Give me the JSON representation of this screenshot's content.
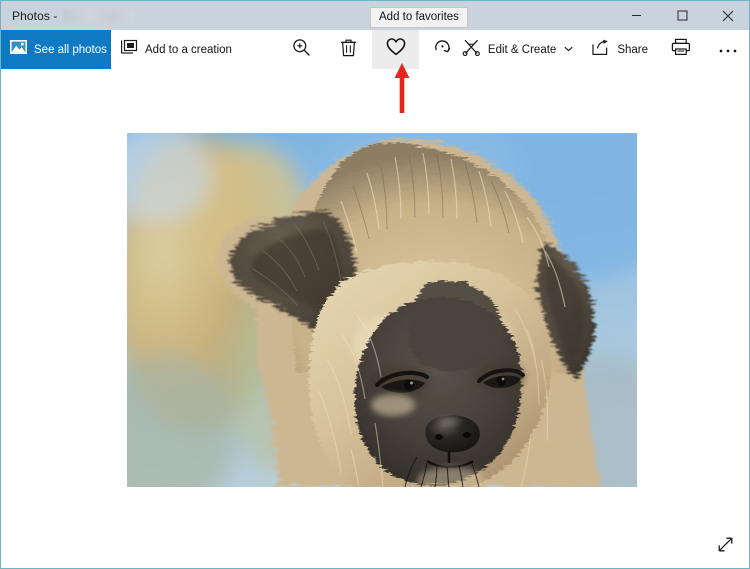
{
  "window": {
    "title": "Photos -",
    "title_redacted": true,
    "accent_blue": "#0e7ac4",
    "titlebar_bg": "#c9d3dd",
    "controls": [
      {
        "name": "minimize",
        "label": "Minimize"
      },
      {
        "name": "maximize",
        "label": "Maximize"
      },
      {
        "name": "close",
        "label": "Close"
      }
    ]
  },
  "toolbar": {
    "see_all_photos": {
      "label": "See all photos",
      "icon": "photo-icon"
    },
    "add_to_creation": {
      "label": "Add to a creation",
      "icon": "add-to-creation-icon"
    },
    "zoom": {
      "icon": "zoom-in-icon",
      "label": "Zoom"
    },
    "delete": {
      "icon": "trash-icon",
      "label": "Delete"
    },
    "favorite": {
      "icon": "heart-icon",
      "label": "Add to favorites",
      "active": true
    },
    "rotate": {
      "icon": "rotate-icon",
      "label": "Rotate"
    },
    "edit_create": {
      "label": "Edit & Create",
      "icon": "edit-create-icon",
      "chevron": "⌄"
    },
    "share": {
      "label": "Share",
      "icon": "share-icon"
    },
    "print": {
      "icon": "print-icon",
      "label": "Print"
    },
    "more": {
      "label": "···",
      "icon": "more-options-icon"
    }
  },
  "tooltip": {
    "text": "Add to favorites",
    "target": "favorite-button"
  },
  "annotation": {
    "type": "arrow",
    "color": "#e8251c",
    "direction": "up",
    "points_to": "favorite-button"
  },
  "viewer": {
    "image_alt": "Close-up photo of a fluffy tan and gray puppy against a blue sky and blurred autumn foliage",
    "expand_button": {
      "icon": "expand-diagonal-icon",
      "label": "Enter fullscreen"
    },
    "photo_colors": {
      "sky": "#87b6dc",
      "foliage": "#c9b27a",
      "fur_light": "#d9c49d",
      "fur_dark": "#4c463f",
      "muzzle": "#3a352f"
    }
  }
}
